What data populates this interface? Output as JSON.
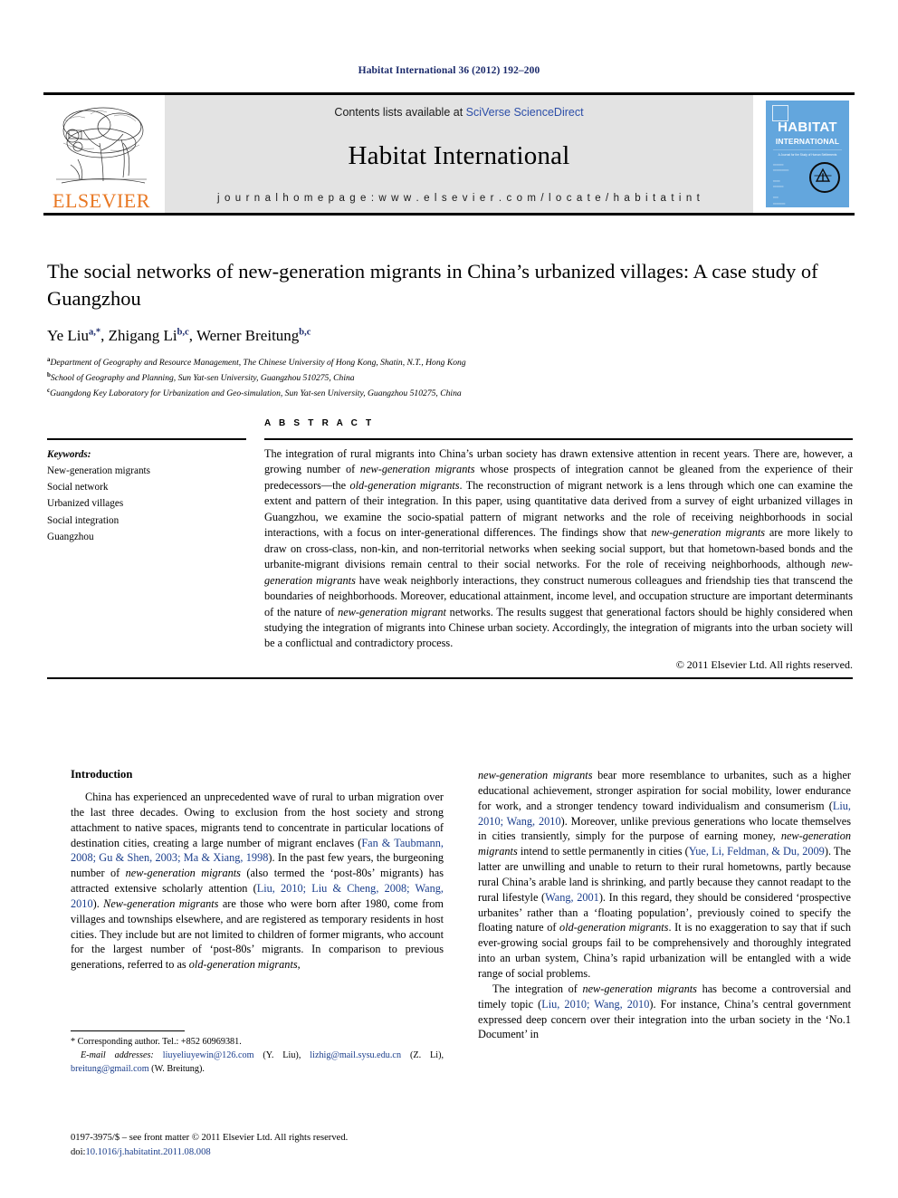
{
  "running_head": "Habitat International 36 (2012) 192–200",
  "masthead": {
    "contents_prefix": "Contents lists available at ",
    "contents_link": "SciVerse ScienceDirect",
    "journal_name": "Habitat International",
    "homepage": "j o u r n a l   h o m e p a g e :   w w w . e l s e v i e r . c o m / l o c a t e / h a b i t a t i n t",
    "publisher_logo_word": "ELSEVIER",
    "cover": {
      "title": "HABITAT",
      "subtitle": "INTERNATIONAL",
      "tagline": "A Journal for the Study of Human Settlements"
    }
  },
  "article": {
    "title": "The social networks of new-generation migrants in China’s urbanized villages: A case study of Guangzhou",
    "authors": [
      {
        "name": "Ye Liu",
        "marks": "a,*"
      },
      {
        "name": "Zhigang Li",
        "marks": "b,c"
      },
      {
        "name": "Werner Breitung",
        "marks": "b,c"
      }
    ],
    "affiliations": [
      {
        "mark": "a",
        "text": "Department of Geography and Resource Management, The Chinese University of Hong Kong, Shatin, N.T., Hong Kong"
      },
      {
        "mark": "b",
        "text": "School of Geography and Planning, Sun Yat-sen University, Guangzhou 510275, China"
      },
      {
        "mark": "c",
        "text": "Guangdong Key Laboratory for Urbanization and Geo-simulation, Sun Yat-sen University, Guangzhou 510275, China"
      }
    ]
  },
  "keywords_panel": {
    "label": "Keywords:",
    "items": [
      "New-generation migrants",
      "Social network",
      "Urbanized villages",
      "Social integration",
      "Guangzhou"
    ]
  },
  "abstract_panel": {
    "heading": "A B S T R A C T",
    "paragraph_html": "The integration of rural migrants into China’s urban society has drawn extensive attention in recent years. There are, however, a growing number of <i>new-generation migrants</i> whose prospects of integration cannot be gleaned from the experience of their predecessors—the <i>old-generation migrants</i>. The reconstruction of migrant network is a lens through which one can examine the extent and pattern of their integration. In this paper, using quantitative data derived from a survey of eight urbanized villages in Guangzhou, we examine the socio-spatial pattern of migrant networks and the role of receiving neighborhoods in social interactions, with a focus on inter-generational differences. The findings show that <i>new-generation migrants</i> are more likely to draw on cross-class, non-kin, and non-territorial networks when seeking social support, but that hometown-based bonds and the urbanite-migrant divisions remain central to their social networks. For the role of receiving neighborhoods, although <i>new-generation migrants</i> have weak neighborly interactions, they construct numerous colleagues and friendship ties that transcend the boundaries of neighborhoods. Moreover, educational attainment, income level, and occupation structure are important determinants of the nature of <i>new-generation migrant</i> networks. The results suggest that generational factors should be highly considered when studying the integration of migrants into Chinese urban society. Accordingly, the integration of migrants into the urban society will be a conflictual and contradictory process.",
    "copyright": "© 2011 Elsevier Ltd. All rights reserved."
  },
  "body": {
    "section_title": "Introduction",
    "left_column_html": "China has experienced an unprecedented wave of rural to urban migration over the last three decades. Owing to exclusion from the host society and strong attachment to native spaces, migrants tend to concentrate in particular locations of destination cities, creating a large number of migrant enclaves (<span class=\"cite\">Fan &amp; Taubmann, 2008; Gu &amp; Shen, 2003; Ma &amp; Xiang, 1998</span>). In the past few years, the burgeoning number of <i>new-generation migrants</i> (also termed the ‘post-80s’ migrants) has attracted extensive scholarly attention (<span class=\"cite\">Liu, 2010; Liu &amp; Cheng, 2008; Wang, 2010</span>). <i>New-generation migrants</i> are those who were born after 1980, come from villages and townships elsewhere, and are registered as temporary residents in host cities. They include but are not limited to children of former migrants, who account for the largest number of ‘post-80s’ migrants. In comparison to previous generations, referred to as <i>old-generation migrants</i>,",
    "right_column_html": "<i>new-generation migrants</i> bear more resemblance to urbanites, such as a higher educational achievement, stronger aspiration for social mobility, lower endurance for work, and a stronger tendency toward individualism and consumerism (<span class=\"cite\">Liu, 2010; Wang, 2010</span>). Moreover, unlike previous generations who locate themselves in cities transiently, simply for the purpose of earning money, <i>new-generation migrants</i> intend to settle permanently in cities (<span class=\"cite\">Yue, Li, Feldman, &amp; Du, 2009</span>). The latter are unwilling and unable to return to their rural hometowns, partly because rural China’s arable land is shrinking, and partly because they cannot readapt to the rural lifestyle (<span class=\"cite\">Wang, 2001</span>). In this regard, they should be considered ‘prospective urbanites’ rather than a ‘floating population’, previously coined to specify the floating nature of <i>old-generation migrants</i>. It is no exaggeration to say that if such ever-growing social groups fail to be comprehensively and thoroughly integrated into an urban system, China’s rapid urbanization will be entangled with a wide range of social problems.",
    "right_column_html_2": "The integration of <i>new-generation migrants</i> has become a controversial and timely topic (<span class=\"cite\">Liu, 2010; Wang, 2010</span>). For instance, China’s central government expressed deep concern over their integration into the urban society in the ‘No.1 Document’ in"
  },
  "footnotes": {
    "corresponding_html": "* Corresponding author. Tel.: +852 60969381.",
    "emails_label": "E-mail addresses:",
    "emails_html": "<span class=\"mail\">liuyeliuyewin@126.com</span> (Y. Liu), <span class=\"mail\">lizhig@mail.sysu.edu.cn</span> (Z. Li), <span class=\"mail\">breitung@gmail.com</span> (W. Breitung)."
  },
  "colophon": {
    "line1": "0197-3975/$ – see front matter © 2011 Elsevier Ltd. All rights reserved.",
    "doi_prefix": "doi:",
    "doi": "10.1016/j.habitatint.2011.08.008"
  }
}
